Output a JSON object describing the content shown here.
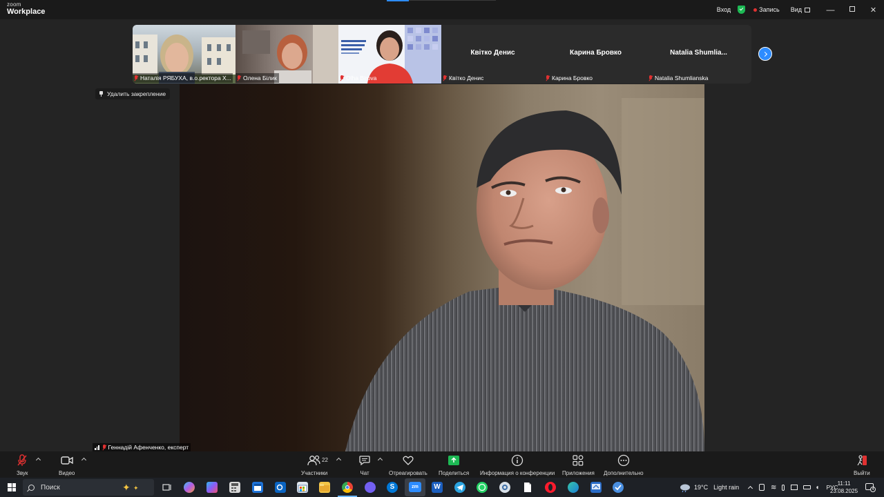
{
  "app": {
    "logo_small": "zoom",
    "logo_big": "Workplace"
  },
  "titlebar": {
    "signin": "Вход",
    "record": "Запись",
    "view": "Вид",
    "minimize": "—",
    "close": "✕"
  },
  "participants": [
    {
      "name": "Наталія РЯБУХА, в.о.ректора Х...",
      "muted": true,
      "video": true
    },
    {
      "name": "Олена Білик",
      "muted": true,
      "video": true
    },
    {
      "name": "Olha Birova",
      "muted": true,
      "video": true
    },
    {
      "display_name": "Квітко Денис",
      "name": "Квітко Денис",
      "muted": true,
      "video": false
    },
    {
      "display_name": "Карина Бровко",
      "name": "Карина Бровко",
      "muted": true,
      "video": false
    },
    {
      "display_name": "Natalia  Shumlia...",
      "name": "Natalia Shumlianska",
      "muted": true,
      "video": false
    }
  ],
  "pin": {
    "label": "Удалить закрепление"
  },
  "speaker": {
    "name": "Геннадій Афенченко, експерт"
  },
  "toolbar": {
    "audio": "Звук",
    "video": "Видео",
    "participants": "Участники",
    "participants_count": "22",
    "chat": "Чат",
    "react": "Отреагировать",
    "share": "Поделиться",
    "info": "Информация о конференции",
    "apps": "Приложения",
    "more": "Дополнительно",
    "leave": "Выйти"
  },
  "taskbar": {
    "search_placeholder": "Поиск",
    "weather_temp": "19°C",
    "weather_desc": "Light rain",
    "lang": "РУС",
    "time": "11:11",
    "date": "23.08.2025",
    "notifications": "4"
  },
  "colors": {
    "accent": "#2d8cff",
    "share_green": "#1db954",
    "muted_red": "#e03131",
    "toolbar_bg": "#1a1a1a",
    "stage_bg": "#242424"
  }
}
